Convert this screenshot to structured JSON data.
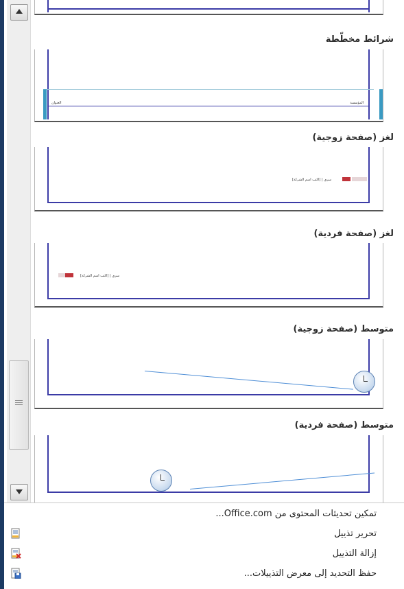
{
  "gallery": {
    "sections": [
      {
        "heading": "شرائط مخطّطة",
        "left_text": "العنوان",
        "right_text": "المؤسسة"
      },
      {
        "heading": "لغز (صفحة زوجية)",
        "caption": "[اكتب اسم الشركة] | سري"
      },
      {
        "heading": "لغز (صفحة فردية)",
        "caption": "[اكتب اسم الشركة] | سري"
      },
      {
        "heading": "متوسط (صفحة زوجية)"
      },
      {
        "heading": "متوسط (صفحة فردية)"
      }
    ]
  },
  "menu": {
    "items": [
      {
        "label": "تمكين تحديثات المحتوى من Office.com...",
        "icon": "none"
      },
      {
        "label": "تحرير تذييل",
        "icon": "edit-footer-icon"
      },
      {
        "label": "إزالة التذييل",
        "icon": "remove-footer-icon"
      },
      {
        "label": "حفظ التحديد إلى معرض التذييلات...",
        "icon": "save-selection-icon"
      }
    ]
  }
}
